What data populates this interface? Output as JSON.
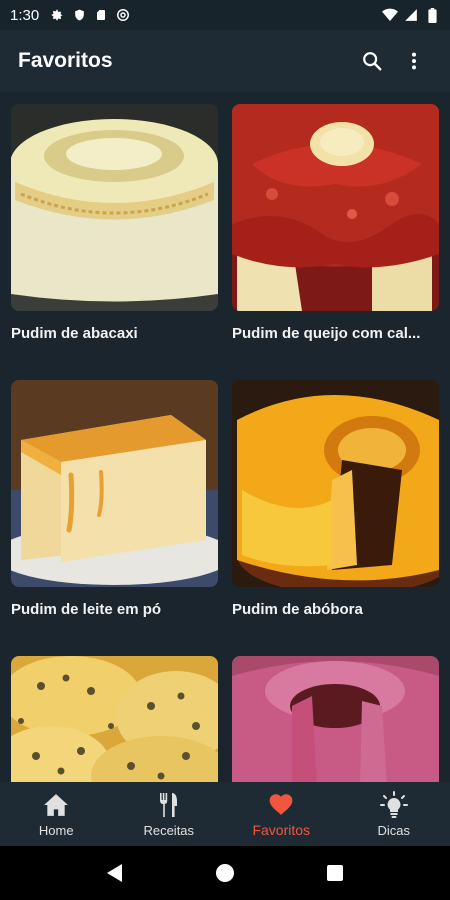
{
  "status_bar": {
    "time": "1:30",
    "left_icons": [
      "gear-icon",
      "shield-icon",
      "sd-card-icon",
      "at-sign-icon"
    ],
    "right_icons": [
      "wifi-icon",
      "signal-icon",
      "battery-icon"
    ]
  },
  "app_bar": {
    "title": "Favoritos",
    "actions": [
      "search-icon",
      "more-vert-icon"
    ]
  },
  "recipes": [
    {
      "title": "Pudim de abacaxi",
      "image": "pineapple-pudding"
    },
    {
      "title": "Pudim de queijo com cal...",
      "image": "cheese-pudding-guava-sauce"
    },
    {
      "title": "Pudim de leite em pó",
      "image": "powdered-milk-pudding"
    },
    {
      "title": "Pudim de abóbora",
      "image": "pumpkin-pudding"
    },
    {
      "title": "",
      "image": "passion-fruit-pudding"
    },
    {
      "title": "",
      "image": "berry-pudding"
    }
  ],
  "bottom_nav": {
    "items": [
      {
        "label": "Home",
        "icon": "home-icon"
      },
      {
        "label": "Receitas",
        "icon": "cutlery-icon"
      },
      {
        "label": "Favoritos",
        "icon": "heart-icon",
        "active": true
      },
      {
        "label": "Dicas",
        "icon": "lightbulb-icon"
      }
    ],
    "active_color": "#f1573f"
  },
  "system_nav": [
    "back-icon",
    "home-circle-icon",
    "recents-icon"
  ]
}
